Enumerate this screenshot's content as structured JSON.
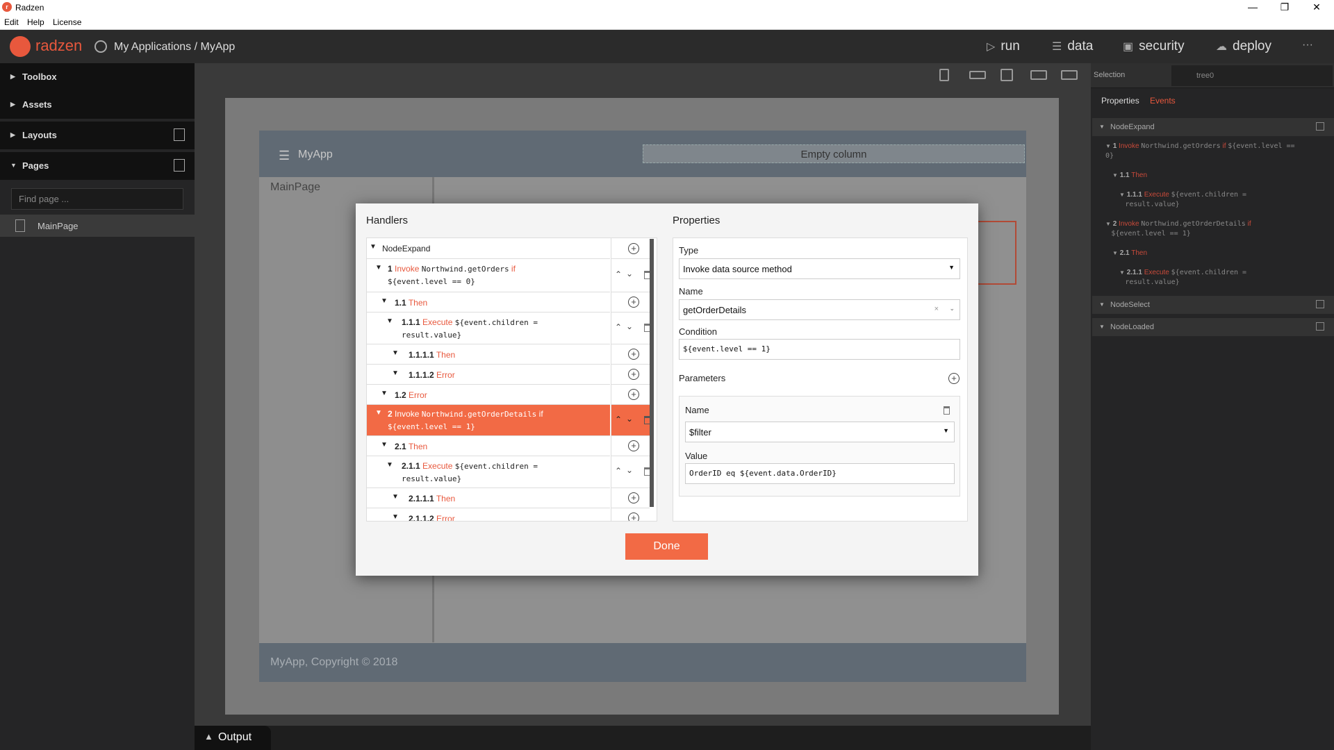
{
  "window": {
    "title": "Radzen",
    "logo_text": "r"
  },
  "menu": [
    "Edit",
    "Help",
    "License"
  ],
  "topbar": {
    "brand": "radzen",
    "breadcrumb": "My Applications / MyApp",
    "nav": [
      {
        "label": "run",
        "icon": "play-icon"
      },
      {
        "label": "data",
        "icon": "layers-icon"
      },
      {
        "label": "security",
        "icon": "lock-icon"
      },
      {
        "label": "deploy",
        "icon": "cloud-upload-icon"
      }
    ],
    "more": "···"
  },
  "sidebar": {
    "sections": [
      "Toolbox",
      "Assets",
      "Layouts",
      "Pages"
    ],
    "find_placeholder": "Find page ...",
    "pages": [
      "MainPage"
    ]
  },
  "canvas": {
    "app_name": "MyApp",
    "empty_column": "Empty column",
    "side_page": "MainPage",
    "footer": "MyApp, Copyright © 2018"
  },
  "output": {
    "label": "Output"
  },
  "selection": {
    "label": "Selection",
    "component": "tree0",
    "tabs": [
      "Properties",
      "Events"
    ],
    "events": [
      {
        "name": "NodeExpand"
      },
      {
        "name": "NodeSelect"
      },
      {
        "name": "NodeLoaded"
      }
    ],
    "lines": [
      {
        "num": "1",
        "kw": "Invoke",
        "code": "Northwind.getOrders",
        "kw2": "if",
        "code2": "${event.level ==",
        "tail": "0}"
      },
      {
        "num": "1.1",
        "kw": "Then"
      },
      {
        "num": "1.1.1",
        "kw": "Execute",
        "code": "${event.children =",
        "tail": "result.value}"
      },
      {
        "num": "2",
        "kw": "Invoke",
        "code": "Northwind.getOrderDetails",
        "kw2": "if",
        "tail": "${event.level == 1}"
      },
      {
        "num": "2.1",
        "kw": "Then"
      },
      {
        "num": "2.1.1",
        "kw": "Execute",
        "code": "${event.children =",
        "tail": "result.value}"
      }
    ]
  },
  "dialog": {
    "handlers_title": "Handlers",
    "properties_title": "Properties",
    "root": "NodeExpand",
    "rows": [
      {
        "num": "1",
        "kw": "Invoke",
        "code": "Northwind.getOrders",
        "kw2": "if",
        "line2": "${event.level == 0}"
      },
      {
        "num": "1.1",
        "kw": "Then"
      },
      {
        "num": "1.1.1",
        "kw": "Execute",
        "code": "${event.children =",
        "line2": "result.value}"
      },
      {
        "num": "1.1.1.1",
        "kw": "Then"
      },
      {
        "num": "1.1.1.2",
        "kw": "Error"
      },
      {
        "num": "1.2",
        "kw": "Error"
      },
      {
        "num": "2",
        "kw": "Invoke",
        "code": "Northwind.getOrderDetails",
        "kw2": "if",
        "line2": "${event.level == 1}"
      },
      {
        "num": "2.1",
        "kw": "Then"
      },
      {
        "num": "2.1.1",
        "kw": "Execute",
        "code": "${event.children =",
        "line2": "result.value}"
      },
      {
        "num": "2.1.1.1",
        "kw": "Then"
      },
      {
        "num": "2.1.1.2",
        "kw": "Error"
      }
    ],
    "props": {
      "type_label": "Type",
      "type_value": "Invoke data source method",
      "name_label": "Name",
      "name_value": "getOrderDetails",
      "condition_label": "Condition",
      "condition_value": "${event.level == 1}",
      "parameters_label": "Parameters",
      "param_name_label": "Name",
      "param_name_value": "$filter",
      "param_value_label": "Value",
      "param_value": "OrderID eq ${event.data.OrderID}"
    },
    "done": "Done"
  },
  "colors": {
    "accent": "#f26a45",
    "brand": "#e8583d",
    "keyword": "#e8583d"
  }
}
